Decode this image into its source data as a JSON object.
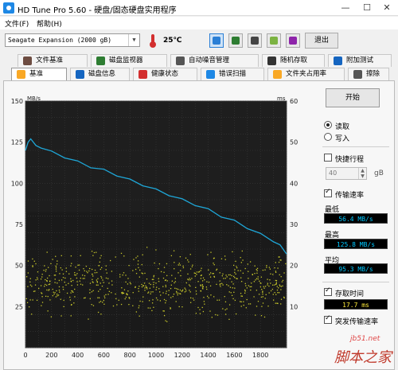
{
  "window": {
    "title": "HD Tune Pro 5.60 - 硬盘/固态硬盘实用程序",
    "minimize": "—",
    "maximize": "☐",
    "close": "✕"
  },
  "menu": [
    "文件(F)",
    "帮助(H)"
  ],
  "toolbar": {
    "drive": "Seagate Expansion (2000 gB)",
    "temperature": "25℃",
    "exit_label": "退出",
    "buttons": [
      {
        "name": "copy-info-icon",
        "active": true,
        "color": "#2a7fd6"
      },
      {
        "name": "copy-text-icon",
        "active": false,
        "color": "#2e7d32"
      },
      {
        "name": "screenshot-icon",
        "active": false,
        "color": "#444444"
      },
      {
        "name": "options-icon",
        "active": false,
        "color": "#7cb342"
      },
      {
        "name": "download-icon",
        "active": false,
        "color": "#8e24aa"
      }
    ]
  },
  "tabs_top": [
    {
      "label": "文件基准",
      "icon": "file-benchmark-icon",
      "color": "#6d4c41"
    },
    {
      "label": "磁盘监视器",
      "icon": "disk-monitor-icon",
      "color": "#2e7d32"
    },
    {
      "label": "自动噪音管理",
      "icon": "noise-icon",
      "color": "#555555"
    },
    {
      "label": "随机存取",
      "icon": "random-access-icon",
      "color": "#333333"
    },
    {
      "label": "附加测试",
      "icon": "extra-tests-icon",
      "color": "#1565c0"
    }
  ],
  "tabs_bottom": [
    {
      "label": "基准",
      "icon": "benchmark-icon",
      "color": "#f9a825",
      "active": true
    },
    {
      "label": "磁盘信息",
      "icon": "disk-info-icon",
      "color": "#1565c0",
      "active": false
    },
    {
      "label": "健康状态",
      "icon": "health-icon",
      "color": "#d32f2f",
      "active": false
    },
    {
      "label": "错误扫描",
      "icon": "error-scan-icon",
      "color": "#1e88e5",
      "active": false
    },
    {
      "label": "文件夹占用率",
      "icon": "folder-usage-icon",
      "color": "#f9a825",
      "active": false
    },
    {
      "label": "擦除",
      "icon": "erase-icon",
      "color": "#555555",
      "active": false
    }
  ],
  "side": {
    "start_label": "开始",
    "read_label": "读取",
    "write_label": "写入",
    "short_stroke_label": "快捷行程",
    "short_stroke_value": "40",
    "short_stroke_unit": "gB",
    "transfer_rate_label": "传输速率",
    "min_label": "最低",
    "min_value": "56.4 MB/s",
    "max_label": "最高",
    "max_value": "125.8 MB/s",
    "avg_label": "平均",
    "avg_value": "95.3 MB/s",
    "access_time_label": "存取时间",
    "access_time_value": "17.7 ms",
    "burst_rate_label": "突发传输速率"
  },
  "watermark": {
    "small": "jb51.net",
    "big": "脚本之家"
  },
  "chart_data": {
    "type": "line",
    "y_left_unit": "MB/s",
    "y_right_unit": "ms",
    "y_left_ticks": [
      25,
      50,
      75,
      100,
      125,
      150
    ],
    "y_right_ticks": [
      10,
      20,
      30,
      40,
      50,
      60
    ],
    "x_ticks": [
      0,
      200,
      400,
      600,
      800,
      1000,
      1200,
      1400,
      1600,
      1800
    ],
    "xlim": [
      0,
      2000
    ],
    "ylim": [
      0,
      150
    ],
    "y_right_lim": [
      0,
      60
    ],
    "grid": true,
    "series": [
      {
        "role": "transfer-rate",
        "color": "#1ea7d8",
        "x": [
          0,
          20,
          40,
          80,
          120,
          200,
          300,
          400,
          500,
          600,
          700,
          800,
          900,
          1000,
          1100,
          1200,
          1300,
          1400,
          1500,
          1600,
          1700,
          1800,
          1900,
          1950,
          2000
        ],
        "y": [
          120,
          125,
          127,
          123,
          122,
          119,
          116,
          113,
          110,
          108,
          105,
          102,
          99,
          96,
          93,
          90,
          87,
          84,
          80,
          77,
          73,
          69,
          65,
          62,
          57
        ]
      },
      {
        "role": "access-time",
        "color": "#e6e62e",
        "x_range": [
          0,
          2000
        ],
        "y_range_ms": [
          5,
          26
        ],
        "density_center_ms": 15,
        "count": 700
      }
    ]
  }
}
